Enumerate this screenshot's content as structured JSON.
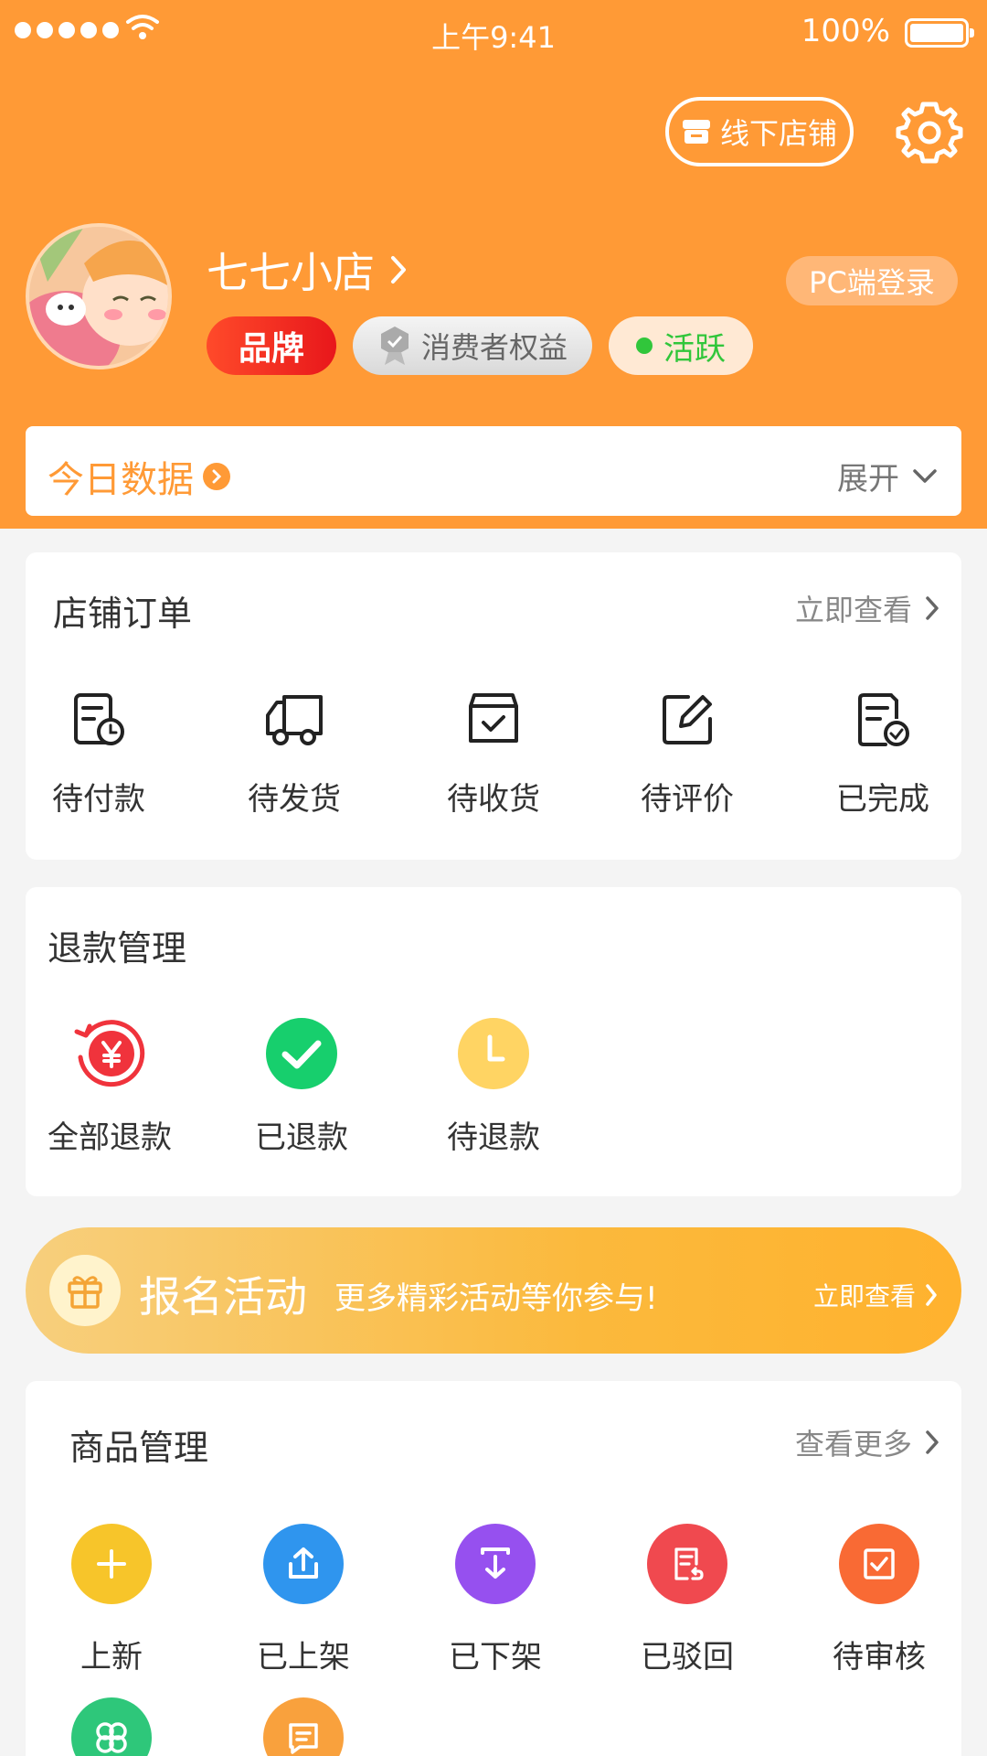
{
  "status_bar": {
    "time": "上午9:41",
    "battery": "100%"
  },
  "header": {
    "offline_store_label": "线下店铺",
    "shop_name": "七七小店",
    "pc_login": "PC端登录",
    "badges": {
      "brand": "品牌",
      "consumer": "消费者权益",
      "active": "活跃"
    }
  },
  "today": {
    "title": "今日数据",
    "expand": "展开"
  },
  "orders": {
    "title": "店铺订单",
    "link": "立即查看",
    "items": [
      {
        "label": "待付款",
        "icon": "pending-payment-icon"
      },
      {
        "label": "待发货",
        "icon": "truck-icon"
      },
      {
        "label": "待收货",
        "icon": "package-check-icon"
      },
      {
        "label": "待评价",
        "icon": "edit-icon"
      },
      {
        "label": "已完成",
        "icon": "document-check-icon"
      }
    ]
  },
  "refunds": {
    "title": "退款管理",
    "items": [
      {
        "label": "全部退款",
        "icon": "yuan-refund-icon",
        "color": "#f0333c"
      },
      {
        "label": "已退款",
        "icon": "check-circle-icon",
        "color": "#17cf6d"
      },
      {
        "label": "待退款",
        "icon": "clock-icon",
        "color": "#ffd463"
      }
    ]
  },
  "activity_banner": {
    "title": "报名活动",
    "subtitle": "更多精彩活动等你参与!",
    "link": "立即查看"
  },
  "products": {
    "title": "商品管理",
    "link": "查看更多",
    "items": [
      {
        "label": "上新",
        "icon": "plus-icon",
        "color": "#f7c52a"
      },
      {
        "label": "已上架",
        "icon": "upload-icon",
        "color": "#2f95ee"
      },
      {
        "label": "已下架",
        "icon": "download-icon",
        "color": "#9650ef"
      },
      {
        "label": "已驳回",
        "icon": "reject-doc-icon",
        "color": "#f0494f"
      },
      {
        "label": "待审核",
        "icon": "review-check-icon",
        "color": "#f96a34"
      },
      {
        "label": "",
        "icon": "clover-icon",
        "color": "#2ec77a"
      },
      {
        "label": "",
        "icon": "message-doc-icon",
        "color": "#f9a13d"
      }
    ]
  },
  "colors": {
    "accent": "#ff9a36",
    "active_green": "#31c63b",
    "brand_red": "#e8171b"
  }
}
